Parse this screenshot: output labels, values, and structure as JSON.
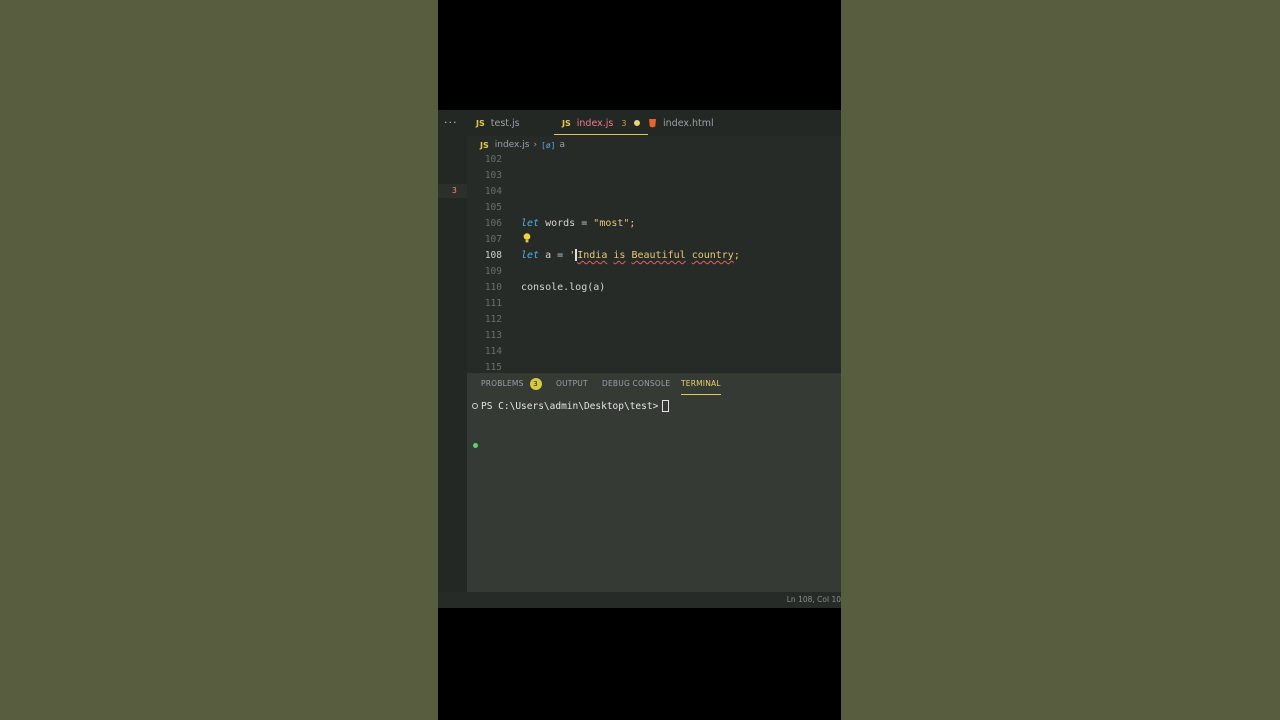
{
  "tabs": [
    {
      "icon": "JS",
      "label": "test.js"
    },
    {
      "icon": "JS",
      "label": "index.js",
      "badge": "3"
    },
    {
      "label": "index.html"
    }
  ],
  "breadcrumb": {
    "file": "index.js",
    "symbol": "a"
  },
  "gutter_badge": "3",
  "code": {
    "line_numbers": [
      "102",
      "103",
      "104",
      "105",
      "106",
      "107",
      "108",
      "109",
      "110",
      "111",
      "112",
      "113",
      "114",
      "115"
    ],
    "line106": {
      "kw": "let",
      "name": "words",
      "op": "=",
      "value": "\"most\";"
    },
    "line108": {
      "kw": "let",
      "name": "a",
      "op": "=",
      "quote": "'",
      "w1": "India",
      "w2": "is",
      "w3": "Beautiful",
      "w4": "country",
      "end": ";"
    },
    "line110": {
      "text": "console.log(a)"
    }
  },
  "panel": {
    "problems_label": "PROBLEMS",
    "problems_count": "3",
    "output_label": "OUTPUT",
    "debug_label": "DEBUG CONSOLE",
    "terminal_label": "TERMINAL",
    "prompt": "PS C:\\Users\\admin\\Desktop\\test>"
  },
  "status": {
    "position": "Ln 108, Col 10"
  },
  "colors": {
    "accent": "#e0c85a",
    "keyword": "#4fb0e6",
    "string": "#e7c87a",
    "error": "#e06060"
  }
}
